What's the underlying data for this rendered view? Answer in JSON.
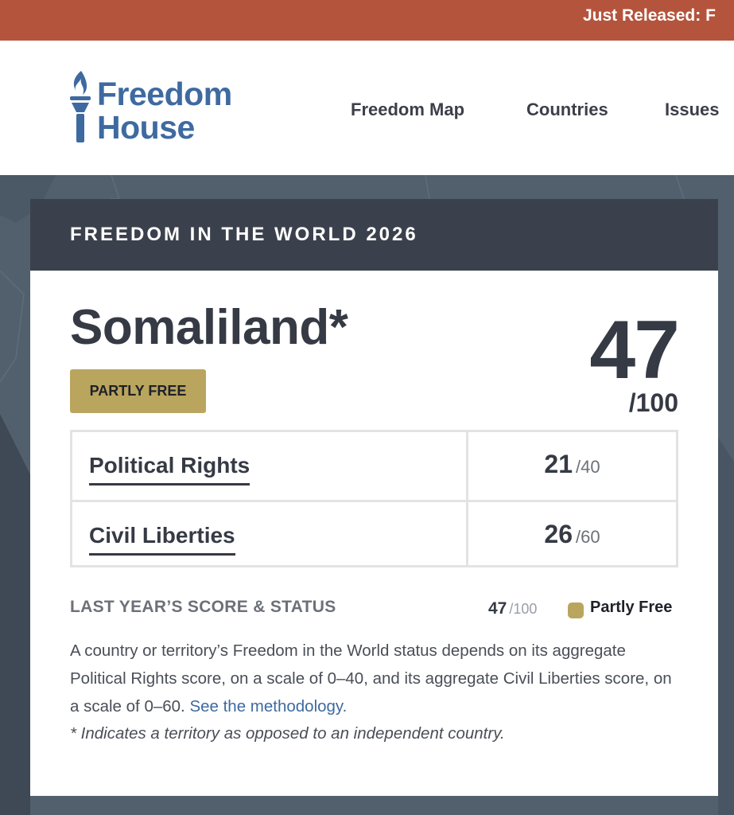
{
  "promo": {
    "text": "Just Released: F"
  },
  "header": {
    "logo_line1": "Freedom",
    "logo_line2": "House",
    "nav": [
      "Freedom Map",
      "Countries",
      "Issues"
    ]
  },
  "report": {
    "banner_title": "FREEDOM IN THE WORLD 2026",
    "country": "Somaliland*",
    "status": "PARTLY FREE",
    "total_score": "47",
    "total_max": "/100",
    "rows": [
      {
        "label": "Political Rights",
        "score": "21",
        "max": "/40"
      },
      {
        "label": "Civil Liberties",
        "score": "26",
        "max": "/60"
      }
    ],
    "last_year": {
      "label": "LAST YEAR’S SCORE & STATUS",
      "score": "47",
      "max": "/100",
      "status": "Partly Free"
    },
    "explain_text": "A country or territory’s Freedom in the World status depends on its aggregate Political Rights score, on a scale of 0–40, and its aggregate Civil Liberties score, on a scale of 0–60. ",
    "methodology_link": "See the methodology.",
    "footnote": "* Indicates a territory as opposed to an independent country."
  },
  "colors": {
    "promo_bg": "#b5543c",
    "brand_blue": "#3e6aa0",
    "banner_bg": "#3b414c",
    "partly_free": "#b9a55e",
    "text_dark": "#353a44"
  },
  "icons": {
    "logo": "torch-icon"
  }
}
